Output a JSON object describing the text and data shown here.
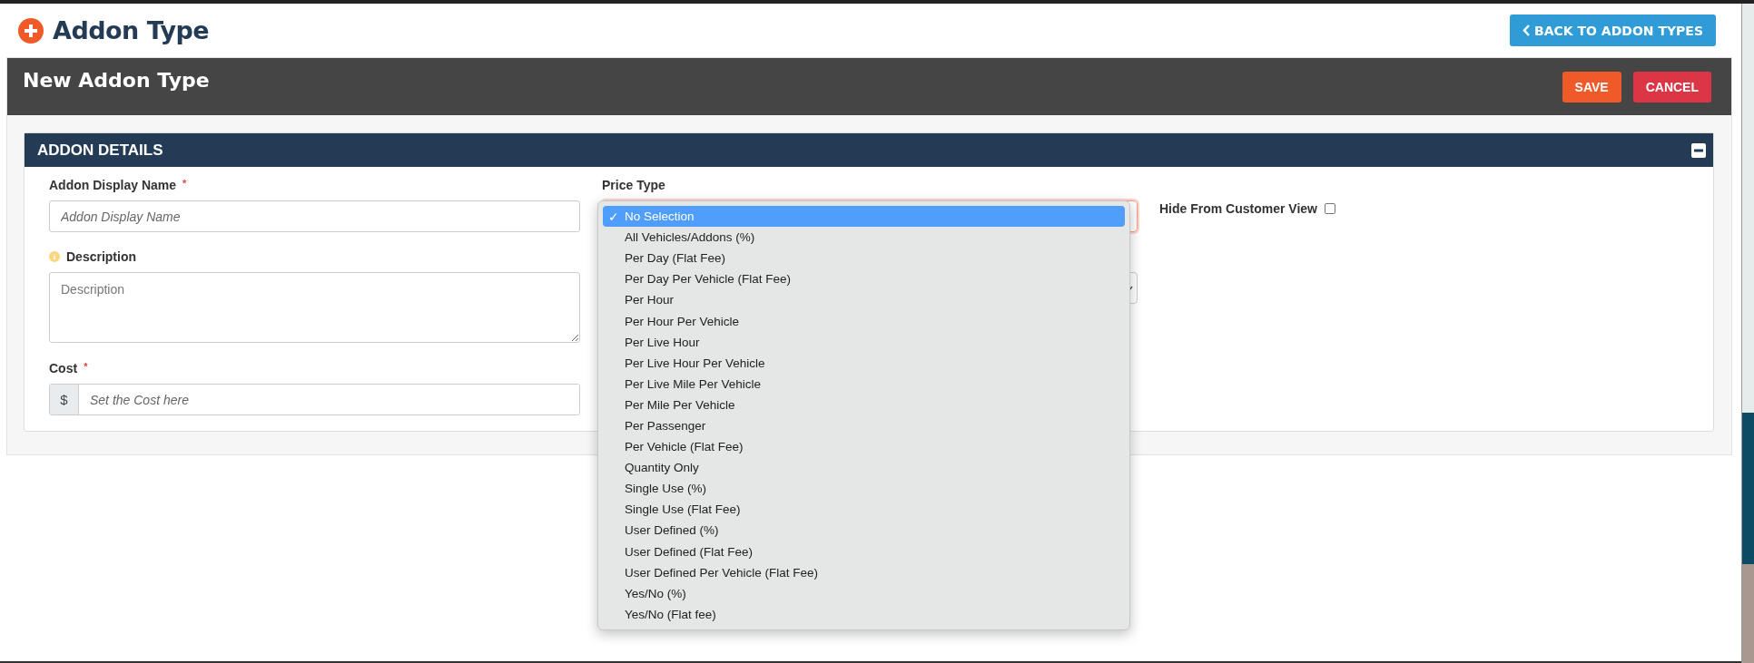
{
  "page": {
    "title": "Addon Type",
    "back_button": "BACK TO ADDON TYPES"
  },
  "form_header": {
    "title": "New Addon Type",
    "buttons": [
      {
        "label": "SAVE",
        "kind": "primary"
      },
      {
        "label": "CANCEL",
        "kind": "danger"
      }
    ]
  },
  "section": {
    "title": "ADDON DETAILS",
    "expanded": true
  },
  "display_name": {
    "label": "Addon Display Name",
    "required_mark": "*",
    "placeholder": "Addon Display Name"
  },
  "description": {
    "label": "Description",
    "placeholder": "Description"
  },
  "cost": {
    "label": "Cost",
    "required_mark": "*",
    "prefix": "$",
    "placeholder": "Set the Cost here"
  },
  "price_type": {
    "label": "Price Type",
    "open": true,
    "check_mark": "✓",
    "options": [
      {
        "label": "No Selection",
        "selected": true
      },
      {
        "label": "All Vehicles/Addons (%)",
        "selected": false
      },
      {
        "label": "Per Day (Flat Fee)",
        "selected": false
      },
      {
        "label": "Per Day Per Vehicle (Flat Fee)",
        "selected": false
      },
      {
        "label": "Per Hour",
        "selected": false
      },
      {
        "label": "Per Hour Per Vehicle",
        "selected": false
      },
      {
        "label": "Per Live Hour",
        "selected": false
      },
      {
        "label": "Per Live Hour Per Vehicle",
        "selected": false
      },
      {
        "label": "Per Live Mile Per Vehicle",
        "selected": false
      },
      {
        "label": "Per Mile Per Vehicle",
        "selected": false
      },
      {
        "label": "Per Passenger",
        "selected": false
      },
      {
        "label": "Per Vehicle (Flat Fee)",
        "selected": false
      },
      {
        "label": "Quantity Only",
        "selected": false
      },
      {
        "label": "Single Use (%)",
        "selected": false
      },
      {
        "label": "Single Use (Flat Fee)",
        "selected": false
      },
      {
        "label": "User Defined (%)",
        "selected": false
      },
      {
        "label": "User Defined (Flat Fee)",
        "selected": false
      },
      {
        "label": "User Defined Per Vehicle (Flat Fee)",
        "selected": false
      },
      {
        "label": "Yes/No (%)",
        "selected": false
      },
      {
        "label": "Yes/No (Flat fee)",
        "selected": false
      }
    ]
  },
  "hide_from_customer": {
    "label": "Hide From Customer View",
    "checked": false
  }
}
